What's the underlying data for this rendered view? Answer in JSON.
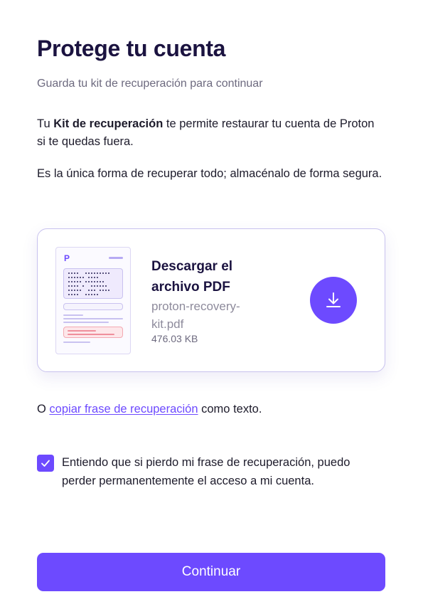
{
  "header": {
    "title": "Protege tu cuenta",
    "subtitle": "Guarda tu kit de recuperación para continuar"
  },
  "intro": {
    "p1_prefix": "Tu ",
    "p1_bold": "Kit de recuperación",
    "p1_suffix": " te permite restaurar tu cuenta de Proton si te quedas fuera.",
    "p2": "Es la única forma de recuperar todo; almacénalo de forma segura."
  },
  "download_card": {
    "title": "Descargar el archivo PDF",
    "file_name": "proton-recovery-kit.pdf",
    "file_size": "476.03 KB",
    "preview_logo": "P",
    "icon": "download-icon"
  },
  "alternative": {
    "prefix": "O ",
    "link": "copiar frase de recuperación",
    "suffix": " como texto."
  },
  "confirmation": {
    "checked": true,
    "label": "Entiendo que si pierdo mi frase de recuperación, puedo perder permanentemente el acceso a mi cuenta."
  },
  "actions": {
    "continue_label": "Continuar"
  },
  "colors": {
    "accent": "#6d4aff",
    "title": "#1b1340",
    "muted": "#6d6a7f"
  }
}
